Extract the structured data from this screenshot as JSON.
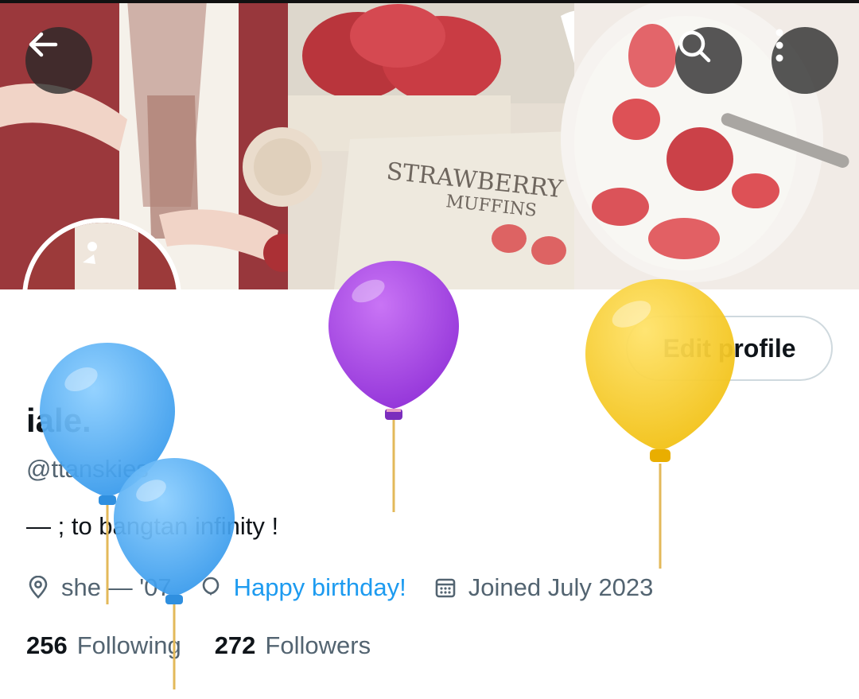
{
  "header": {
    "back_icon": "arrow-left-icon",
    "search_icon": "search-icon",
    "more_icon": "more-vertical-icon"
  },
  "banner": {
    "handwritten_text_line1": "STRAWBERRY",
    "handwritten_text_line2": "MUFFINS"
  },
  "profile": {
    "name": "iale.",
    "handle": "@ttanskies",
    "bio": "— ; to bangtan infinity !",
    "edit_profile_label": "Edit profile",
    "location": "she — '07",
    "birthday_label": "Happy birthday!",
    "joined": "Joined July 2023",
    "following_count": "256",
    "following_label": "Following",
    "followers_count": "272",
    "followers_label": "Followers"
  },
  "colors": {
    "link_blue": "#1d9bf0",
    "muted_text": "#536471",
    "balloon_blue": "#4aa8f2",
    "balloon_purple": "#a341e0",
    "balloon_yellow": "#f6cc22"
  }
}
